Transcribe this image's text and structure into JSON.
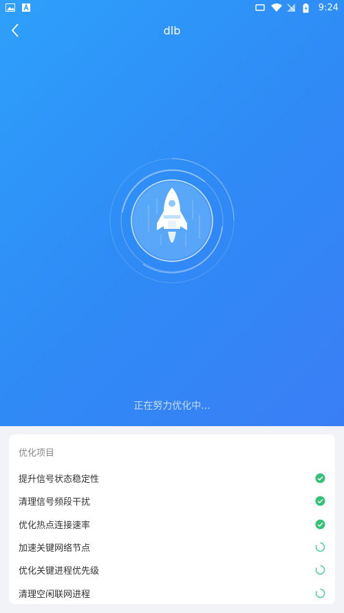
{
  "statusbar": {
    "left_icons": [
      "image-icon",
      "a-icon"
    ],
    "right_icons": [
      "cast-icon",
      "wifi-icon",
      "no-signal-icon",
      "battery-icon"
    ],
    "time": "9:24"
  },
  "header": {
    "title": "dlb",
    "back_icon": "chevron-left-icon"
  },
  "hero": {
    "status_text": "正在努力优化中..."
  },
  "card": {
    "title": "优化项目",
    "items": [
      {
        "label": "提升信号状态稳定性",
        "state": "done"
      },
      {
        "label": "清理信号频段干扰",
        "state": "done"
      },
      {
        "label": "优化热点连接速率",
        "state": "done"
      },
      {
        "label": "加速关键网络节点",
        "state": "loading"
      },
      {
        "label": "优化关键进程优先级",
        "state": "loading"
      },
      {
        "label": "清理空闲联网进程",
        "state": "loading"
      }
    ]
  },
  "colors": {
    "hero_start": "#2ea0fb",
    "hero_end": "#3a7ef5",
    "done_green": "#35c278",
    "loading_green": "#4ccf92"
  }
}
